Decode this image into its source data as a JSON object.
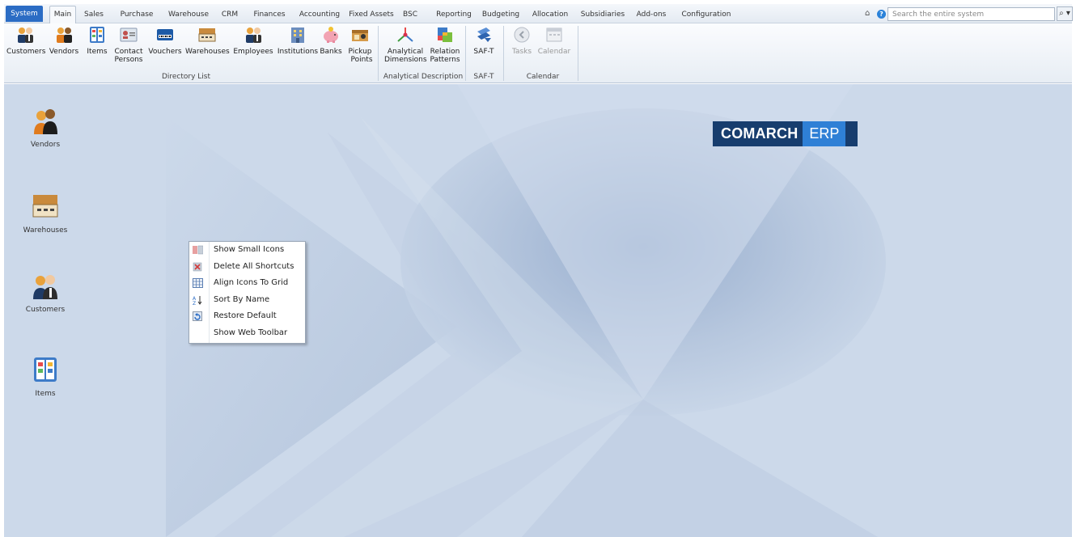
{
  "menu_tabs": [
    "System",
    "Main",
    "Sales",
    "Purchase",
    "Warehouse",
    "CRM",
    "Finances",
    "Accounting",
    "Fixed Assets",
    "BSC",
    "Reporting",
    "Budgeting",
    "Allocation",
    "Subsidiaries",
    "Add-ons",
    "Configuration"
  ],
  "active_tab": "Main",
  "search": {
    "placeholder": "Search the entire system",
    "button_icon": "⌕ ▾"
  },
  "ribbon": {
    "buttons": {
      "customers": "Customers",
      "vendors": "Vendors",
      "items": "Items",
      "contact_persons_1": "Contact",
      "contact_persons_2": "Persons",
      "vouchers": "Vouchers",
      "warehouses": "Warehouses",
      "employees": "Employees",
      "institutions": "Institutions",
      "banks": "Banks",
      "pickup_points_1": "Pickup",
      "pickup_points_2": "Points",
      "analytical_dimensions_1": "Analytical",
      "analytical_dimensions_2": "Dimensions",
      "relation_patterns_1": "Relation",
      "relation_patterns_2": "Patterns",
      "saft": "SAF-T",
      "tasks": "Tasks",
      "calendar": "Calendar"
    },
    "groups": {
      "directory_list": "Directory List",
      "analytical_description": "Analytical Description",
      "saft": "SAF-T",
      "calendar": "Calendar"
    }
  },
  "desktop_shortcuts": {
    "vendors": "Vendors",
    "warehouses": "Warehouses",
    "customers": "Customers",
    "items": "Items"
  },
  "logo": {
    "brand": "COMARCH",
    "product": "ERP"
  },
  "context_menu": {
    "show_small_icons": "Show Small Icons",
    "delete_all_shortcuts": "Delete All Shortcuts",
    "align_icons_to_grid": "Align Icons To Grid",
    "sort_by_name": "Sort By Name",
    "restore_default": "Restore Default",
    "show_web_toolbar": "Show Web Toolbar"
  },
  "colors": {
    "accent": "#2b6cc4",
    "desktop_bg": "#ccd9ea",
    "logo_dark": "#173d6e",
    "logo_light": "#2f80d6"
  }
}
